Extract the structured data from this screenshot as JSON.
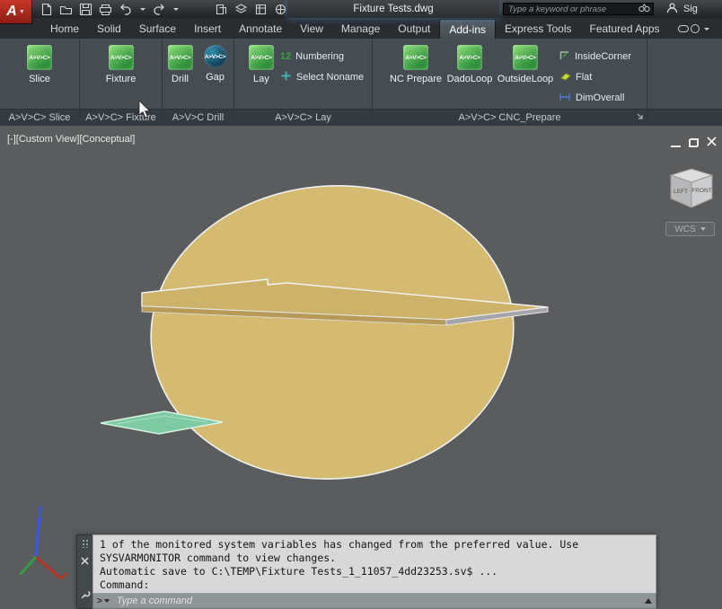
{
  "titlebar": {
    "logo_text": "A",
    "title": "Fixture Tests.dwg",
    "search_placeholder": "Type a keyword or phrase",
    "signin_label": "Sig"
  },
  "tabs": [
    {
      "label": "Home"
    },
    {
      "label": "Solid"
    },
    {
      "label": "Surface"
    },
    {
      "label": "Insert"
    },
    {
      "label": "Annotate"
    },
    {
      "label": "View"
    },
    {
      "label": "Manage"
    },
    {
      "label": "Output"
    },
    {
      "label": "Add-ins"
    },
    {
      "label": "Express Tools"
    },
    {
      "label": "Featured Apps"
    }
  ],
  "ribbon": {
    "icon_text": "A>V>C>",
    "numbering_icon_text": "12",
    "panels": [
      {
        "title": "A>V>C> Slice",
        "buttons": [
          {
            "label": "Slice"
          }
        ]
      },
      {
        "title": "A>V>C> Fixture",
        "buttons": [
          {
            "label": "Fixture"
          }
        ]
      },
      {
        "title": "A>V>C Drill",
        "buttons": [
          {
            "label": "Drill"
          },
          {
            "label": "Gap"
          }
        ]
      },
      {
        "title": "A>V>C> Lay",
        "buttons": [
          {
            "label": "Lay"
          }
        ],
        "small_buttons": [
          {
            "label": "Numbering"
          },
          {
            "label": "Select Noname"
          }
        ]
      },
      {
        "title": "A>V>C> CNC_Prepare",
        "buttons": [
          {
            "label": "NC Prepare"
          },
          {
            "label": "DadoLoop"
          },
          {
            "label": "OutsideLoop"
          }
        ],
        "small_buttons": [
          {
            "label": "InsideCorner"
          },
          {
            "label": "Flat"
          },
          {
            "label": "DimOverall"
          }
        ]
      }
    ]
  },
  "viewport": {
    "label": "[-][Custom View][Conceptual]",
    "viewcube": {
      "left_face": "LEFT",
      "front_face": "FRONT"
    },
    "wcs_label": "WCS"
  },
  "command": {
    "prompt_symbol": ">",
    "history": [
      "1 of the monitored system variables has changed from the preferred value. Use",
      "SYSVARMONITOR command to view changes.",
      "Automatic save to C:\\TEMP\\Fixture Tests_1_11057_4dd23253.sv$ ...",
      "Command:"
    ],
    "input_placeholder": "Type a command"
  },
  "colors": {
    "ribbon_bg": "#454d52",
    "viewport_bg": "#5a5c5e",
    "disc_tan": "#d5bb72",
    "board_tan": "#cdb36a",
    "board_edge": "#b79a55",
    "plate_green": "#7ecba3",
    "cmd_bg": "#d8d8d8"
  }
}
